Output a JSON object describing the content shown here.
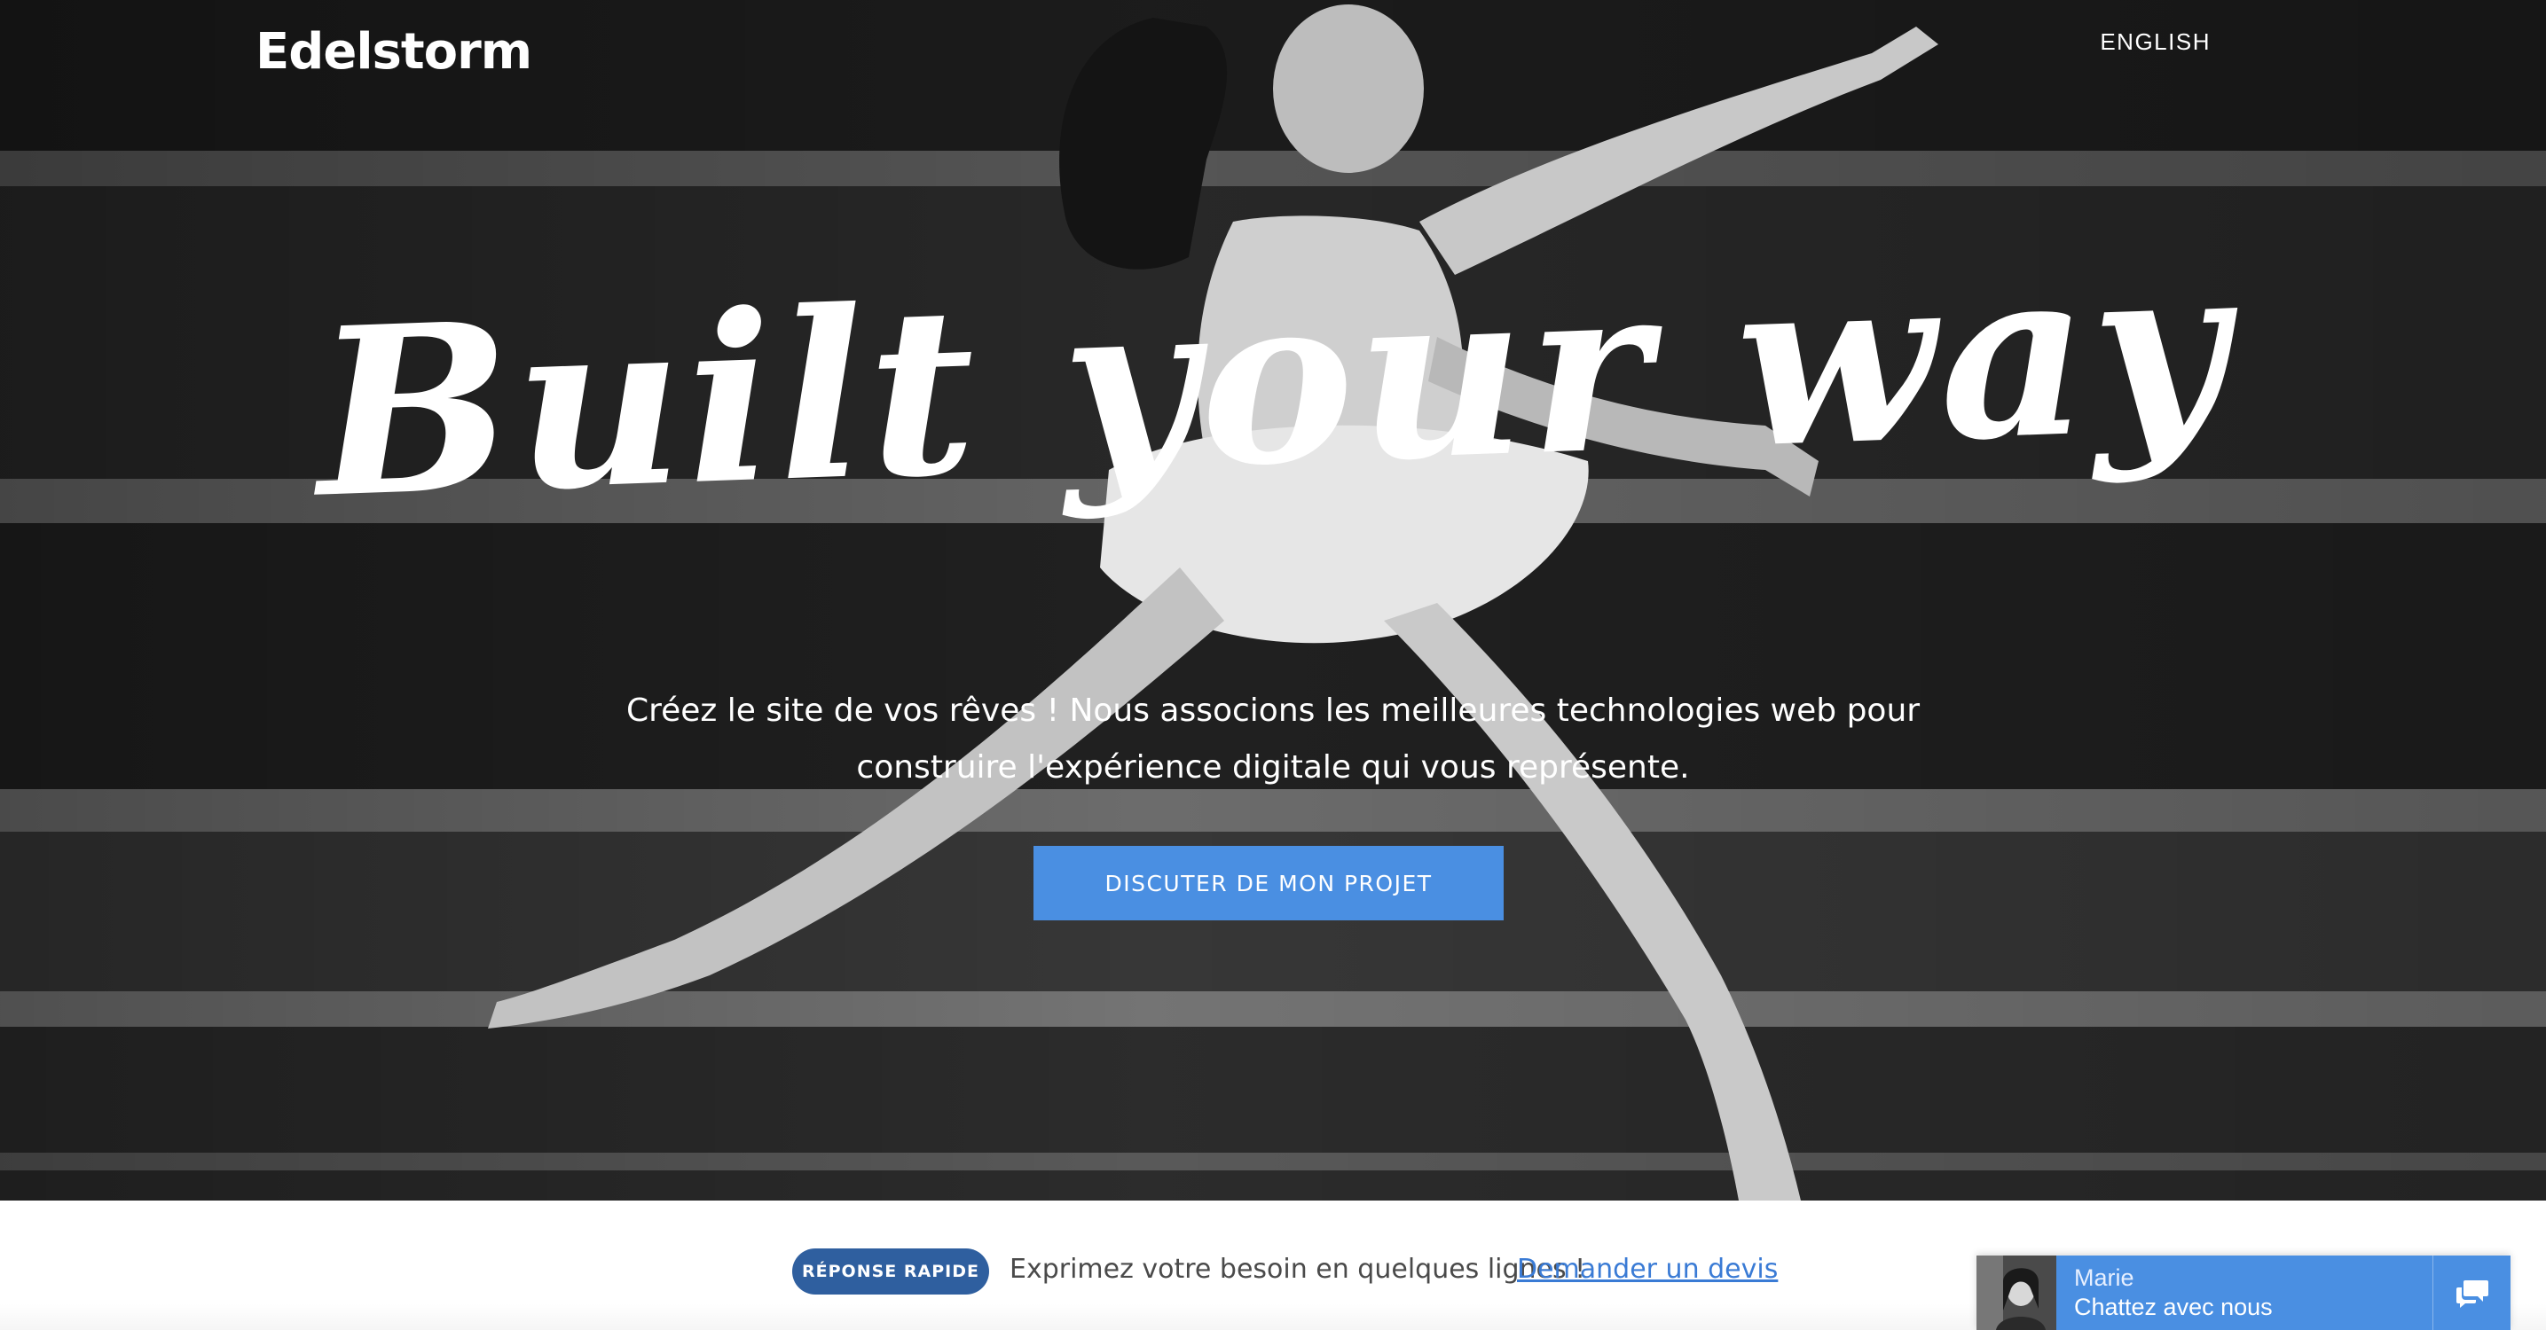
{
  "header": {
    "logo": "Edelstorm",
    "language_link": "ENGLISH"
  },
  "hero": {
    "headline": "Built your way",
    "subtitle_line1": "Créez le site de vos rêves ! Nous associons les meilleures technologies web pour",
    "subtitle_line2": "construire l'expérience digitale qui vous représente.",
    "cta_label": "DISCUTER DE MON PROJET"
  },
  "bottom_bar": {
    "badge": "RÉPONSE RAPIDE",
    "text": "Exprimez votre besoin en quelques lignes !",
    "link": "Demander un devis"
  },
  "chat": {
    "agent_name": "Marie",
    "cta": "Chattez avec nous",
    "icon": "chat-bubbles-icon"
  },
  "colors": {
    "accent": "#4a8fe2",
    "badge": "#2f5f9f",
    "link": "#3a7bd5"
  }
}
